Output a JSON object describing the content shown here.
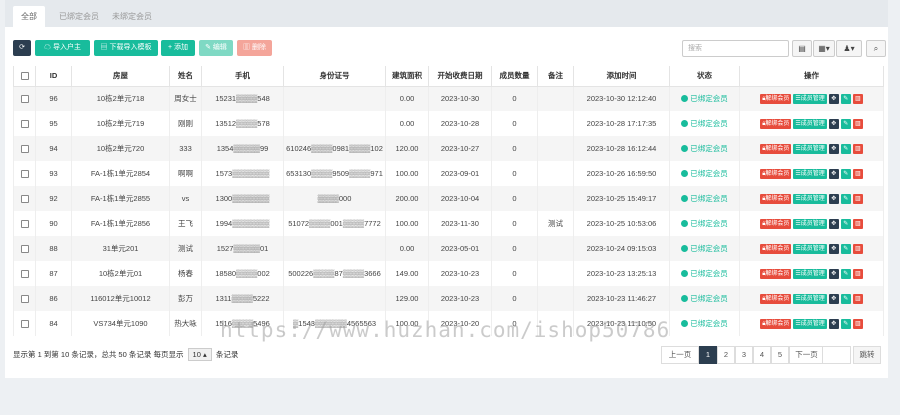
{
  "tabs": [
    "全部",
    "已绑定会员",
    "未绑定会员"
  ],
  "toolbar": {
    "import_owner": "导入户主",
    "download_template": "下载导入模板",
    "add": "添加",
    "edit": "编辑",
    "delete": "删除"
  },
  "search": {
    "placeholder": "搜索"
  },
  "columns": [
    "ID",
    "房屋",
    "姓名",
    "手机",
    "身份证号",
    "建筑面积",
    "开始收费日期",
    "成员数量",
    "备注",
    "添加时间",
    "状态",
    "操作"
  ],
  "rows": [
    {
      "id": "96",
      "house": "10栋2单元718",
      "name": "周女士",
      "phone": "15231▒▒▒▒548",
      "idcard": "",
      "area": "0.00",
      "start": "2023-10-30",
      "members": "0",
      "note": "",
      "added": "2023-10-30 12:12:40",
      "status": "已绑定会员"
    },
    {
      "id": "95",
      "house": "10栋2单元719",
      "name": "刚刚",
      "phone": "13512▒▒▒▒578",
      "idcard": "",
      "area": "0.00",
      "start": "2023-10-28",
      "members": "0",
      "note": "",
      "added": "2023-10-28 17:17:35",
      "status": "已绑定会员"
    },
    {
      "id": "94",
      "house": "10栋2单元720",
      "name": "333",
      "phone": "1354▒▒▒▒▒99",
      "idcard": "610246▒▒▒▒0981▒▒▒▒102",
      "area": "120.00",
      "start": "2023-10-27",
      "members": "0",
      "note": "",
      "added": "2023-10-28 16:12:44",
      "status": "已绑定会员"
    },
    {
      "id": "93",
      "house": "FA-1栋1单元2854",
      "name": "啊啊",
      "phone": "1573▒▒▒▒▒▒▒",
      "idcard": "653130▒▒▒▒9509▒▒▒▒971",
      "area": "100.00",
      "start": "2023-09-01",
      "members": "0",
      "note": "",
      "added": "2023-10-26 16:59:50",
      "status": "已绑定会员"
    },
    {
      "id": "92",
      "house": "FA-1栋1单元2855",
      "name": "vs",
      "phone": "1300▒▒▒▒▒▒▒",
      "idcard": "▒▒▒▒000",
      "area": "200.00",
      "start": "2023-10-04",
      "members": "0",
      "note": "",
      "added": "2023-10-25 15:49:17",
      "status": "已绑定会员"
    },
    {
      "id": "90",
      "house": "FA-1栋1单元2856",
      "name": "王飞",
      "phone": "1994▒▒▒▒▒▒▒",
      "idcard": "51072▒▒▒▒001▒▒▒▒7772",
      "area": "100.00",
      "start": "2023-11-30",
      "members": "0",
      "note": "测试",
      "added": "2023-10-25 10:53:06",
      "status": "已绑定会员"
    },
    {
      "id": "88",
      "house": "31单元201",
      "name": "测试",
      "phone": "1527▒▒▒▒▒01",
      "idcard": "",
      "area": "0.00",
      "start": "2023-05-01",
      "members": "0",
      "note": "",
      "added": "2023-10-24 09:15:03",
      "status": "已绑定会员"
    },
    {
      "id": "87",
      "house": "10栋2单元01",
      "name": "杨春",
      "phone": "18580▒▒▒▒002",
      "idcard": "500226▒▒▒▒87▒▒▒▒3666",
      "area": "149.00",
      "start": "2023-10-23",
      "members": "0",
      "note": "",
      "added": "2023-10-23 13:25:13",
      "status": "已绑定会员"
    },
    {
      "id": "86",
      "house": "116012单元10012",
      "name": "彭万",
      "phone": "1311▒▒▒▒5222",
      "idcard": "",
      "area": "129.00",
      "start": "2023-10-23",
      "members": "0",
      "note": "",
      "added": "2023-10-23 11:46:27",
      "status": "已绑定会员"
    },
    {
      "id": "84",
      "house": "VS734单元1090",
      "name": "热大咏",
      "phone": "1516▒▒▒▒5496",
      "idcard": "▒1543▒▒▒▒▒▒4565563",
      "area": "100.00",
      "start": "2023-10-20",
      "members": "0",
      "note": "",
      "added": "2023-10-23 11:10:50",
      "status": "已绑定会员"
    }
  ],
  "row_actions": {
    "unbind": "解绑会员",
    "members": "成员管理"
  },
  "footer": {
    "summary": "显示第 1 到第 10 条记录，总共 50 条记录 每页显示",
    "page_size": "10",
    "per_page_suffix": "条记录"
  },
  "pagination": {
    "prev": "上一页",
    "pages": [
      "1",
      "2",
      "3",
      "4",
      "5"
    ],
    "next": "下一页",
    "jump": "跳转"
  },
  "watermark": "https://www.huzhan.com/ishop50786",
  "colors": {
    "accent_green": "#18bc9c",
    "dark": "#2c3e50",
    "danger": "#e74c3c"
  }
}
